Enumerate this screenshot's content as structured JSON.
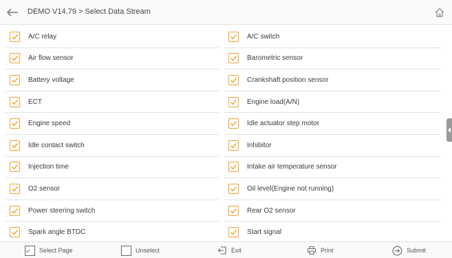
{
  "header": {
    "title": "DEMO V14.79 > Select Data Stream"
  },
  "items": [
    [
      "A/C relay",
      "A/C switch"
    ],
    [
      "Air flow sensor",
      "Barometric sensor"
    ],
    [
      "Battery voltage",
      "Crankshaft position sensor"
    ],
    [
      "ECT",
      "Engine load(A/N)"
    ],
    [
      "Engine speed",
      "Idle actuator step motor"
    ],
    [
      "Idle contact switch",
      "Inhibitor"
    ],
    [
      "Injection time",
      "Intake air temperature sensor"
    ],
    [
      "O2 sensor",
      "Oil level(Engine not running)"
    ],
    [
      "Power steering switch",
      "Rear O2 sensor"
    ],
    [
      "Spark angle BTDC",
      "Start signal"
    ]
  ],
  "footer": {
    "select_page": "Select Page",
    "unselect": "Unselect",
    "exit": "Exit",
    "print": "Print",
    "submit": "Submit"
  },
  "colors": {
    "checkbox_accent": "#f0a030"
  }
}
